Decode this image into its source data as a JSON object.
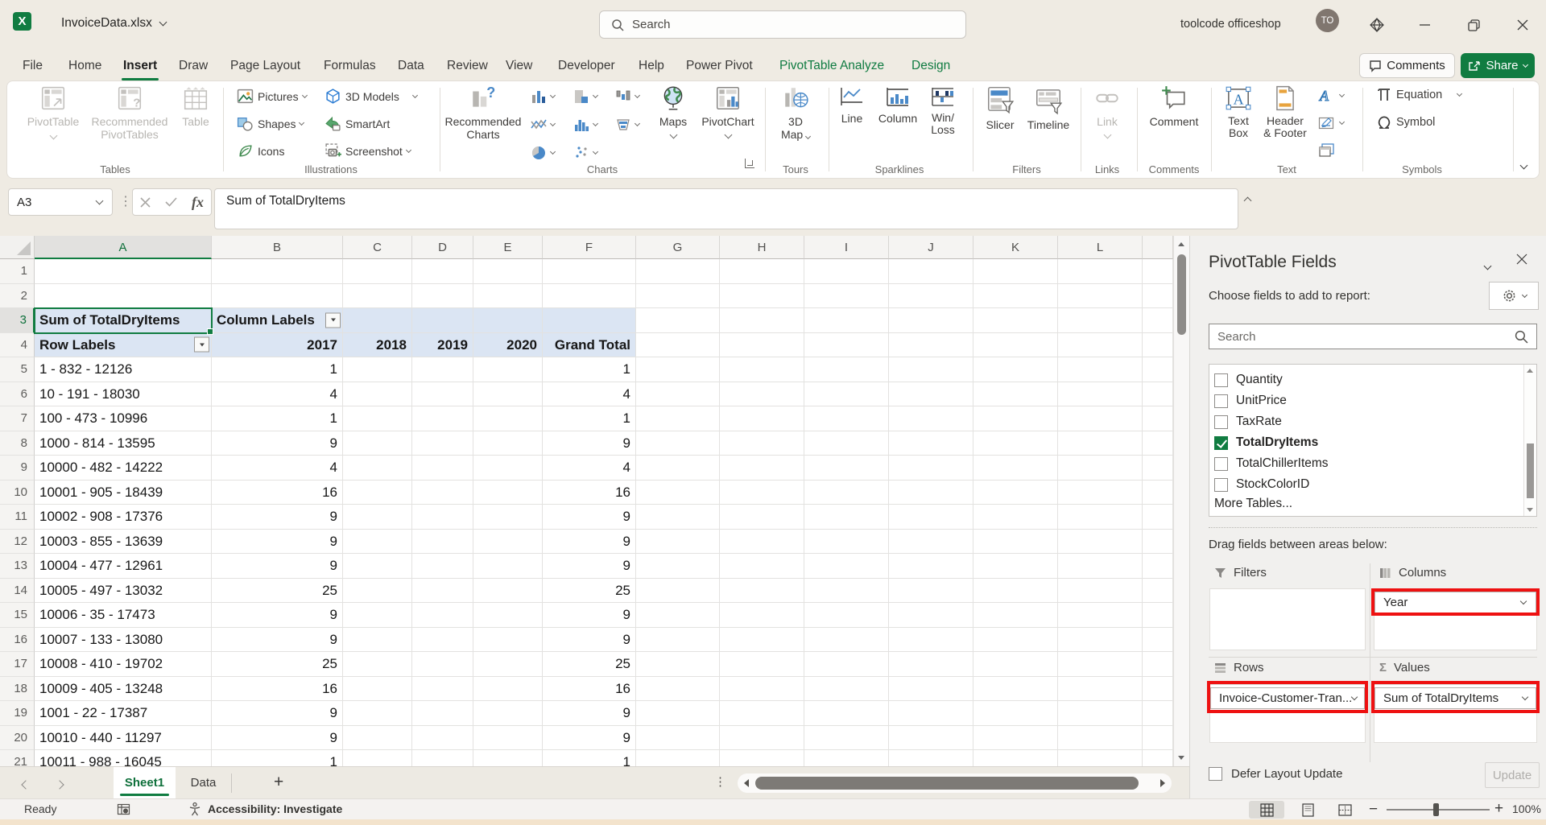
{
  "titlebar": {
    "doc_title": "InvoiceData.xlsx",
    "search_placeholder": "Search",
    "account_name": "toolcode officeshop",
    "avatar_initials": "TO"
  },
  "ribbon": {
    "tabs": [
      {
        "label": "File"
      },
      {
        "label": "Home"
      },
      {
        "label": "Insert",
        "active": true
      },
      {
        "label": "Draw"
      },
      {
        "label": "Page Layout"
      },
      {
        "label": "Formulas"
      },
      {
        "label": "Data"
      },
      {
        "label": "Review"
      },
      {
        "label": "View"
      },
      {
        "label": "Developer"
      },
      {
        "label": "Help"
      },
      {
        "label": "Power Pivot"
      },
      {
        "label": "PivotTable Analyze",
        "green": true
      },
      {
        "label": "Design",
        "green": true
      }
    ],
    "comments_label": "Comments",
    "share_label": "Share",
    "tables": {
      "pivottable": "PivotTable",
      "recommended": "Recommended PivotTables",
      "table": "Table",
      "group": "Tables"
    },
    "illustrations": {
      "pictures": "Pictures",
      "shapes": "Shapes",
      "icons": "Icons",
      "models": "3D Models",
      "smartart": "SmartArt",
      "screenshot": "Screenshot",
      "group": "Illustrations"
    },
    "charts": {
      "recommended": "Recommended Charts",
      "maps": "Maps",
      "pivotchart": "PivotChart",
      "group": "Charts"
    },
    "tours": {
      "map3d": "3D Map",
      "group": "Tours"
    },
    "sparklines": {
      "line": "Line",
      "column": "Column",
      "winloss": "Win/ Loss",
      "group": "Sparklines"
    },
    "filters": {
      "slicer": "Slicer",
      "timeline": "Timeline",
      "group": "Filters"
    },
    "links": {
      "link": "Link",
      "group": "Links"
    },
    "comments": {
      "comment": "Comment",
      "group": "Comments"
    },
    "text": {
      "textbox": "Text Box",
      "headerfooter": "Header & Footer",
      "group": "Text"
    },
    "symbols": {
      "equation": "Equation",
      "symbol": "Symbol",
      "group": "Symbols"
    }
  },
  "formula_bar": {
    "name_box": "A3",
    "fx": "fx",
    "formula": "Sum of TotalDryItems"
  },
  "sheet": {
    "columns": [
      "A",
      "B",
      "C",
      "D",
      "E",
      "F",
      "G",
      "H",
      "I",
      "J",
      "K",
      "L",
      ""
    ],
    "selected_column": "A",
    "selected_row": 3,
    "pivot": {
      "a3": "Sum of TotalDryItems",
      "b3": "Column Labels",
      "row_labels": "Row Labels",
      "years": [
        "2017",
        "2018",
        "2019",
        "2020"
      ],
      "grand_total_label": "Grand Total",
      "rows": [
        {
          "label": "1 - 832 - 12126",
          "y2017": "1",
          "total": "1"
        },
        {
          "label": "10 - 191 - 18030",
          "y2017": "4",
          "total": "4"
        },
        {
          "label": "100 - 473 - 10996",
          "y2017": "1",
          "total": "1"
        },
        {
          "label": "1000 - 814 - 13595",
          "y2017": "9",
          "total": "9"
        },
        {
          "label": "10000 - 482 - 14222",
          "y2017": "4",
          "total": "4"
        },
        {
          "label": "10001 - 905 - 18439",
          "y2017": "16",
          "total": "16"
        },
        {
          "label": "10002 - 908 - 17376",
          "y2017": "9",
          "total": "9"
        },
        {
          "label": "10003 - 855 - 13639",
          "y2017": "9",
          "total": "9"
        },
        {
          "label": "10004 - 477 - 12961",
          "y2017": "9",
          "total": "9"
        },
        {
          "label": "10005 - 497 - 13032",
          "y2017": "25",
          "total": "25"
        },
        {
          "label": "10006 - 35 - 17473",
          "y2017": "9",
          "total": "9"
        },
        {
          "label": "10007 - 133 - 13080",
          "y2017": "9",
          "total": "9"
        },
        {
          "label": "10008 - 410 - 19702",
          "y2017": "25",
          "total": "25"
        },
        {
          "label": "10009 - 405 - 13248",
          "y2017": "16",
          "total": "16"
        },
        {
          "label": "1001 - 22 - 17387",
          "y2017": "9",
          "total": "9"
        },
        {
          "label": "10010 - 440 - 11297",
          "y2017": "9",
          "total": "9"
        },
        {
          "label": "10011 - 988 - 16045",
          "y2017": "1",
          "total": "1"
        }
      ]
    }
  },
  "pane": {
    "title": "PivotTable Fields",
    "choose_label": "Choose fields to add to report:",
    "search_placeholder": "Search",
    "fields": [
      {
        "name": "Quantity",
        "checked": false
      },
      {
        "name": "UnitPrice",
        "checked": false
      },
      {
        "name": "TaxRate",
        "checked": false
      },
      {
        "name": "TotalDryItems",
        "checked": true
      },
      {
        "name": "TotalChillerItems",
        "checked": false
      },
      {
        "name": "StockColorID",
        "checked": false
      }
    ],
    "more_tables": "More Tables...",
    "drag_label": "Drag fields between areas below:",
    "areas": {
      "filters": "Filters",
      "columns": "Columns",
      "rows": "Rows",
      "values": "Values"
    },
    "pills": {
      "columns": "Year",
      "rows": "Invoice-Customer-Tran...",
      "values": "Sum of TotalDryItems"
    },
    "defer_label": "Defer Layout Update",
    "update_label": "Update",
    "highlight_color": "#ee1111"
  },
  "sheetbar": {
    "tabs": [
      "Sheet1",
      "Data"
    ],
    "active_tab": "Sheet1",
    "add_label": "+"
  },
  "statusbar": {
    "ready": "Ready",
    "accessibility": "Accessibility: Investigate",
    "zoom": "100%"
  }
}
